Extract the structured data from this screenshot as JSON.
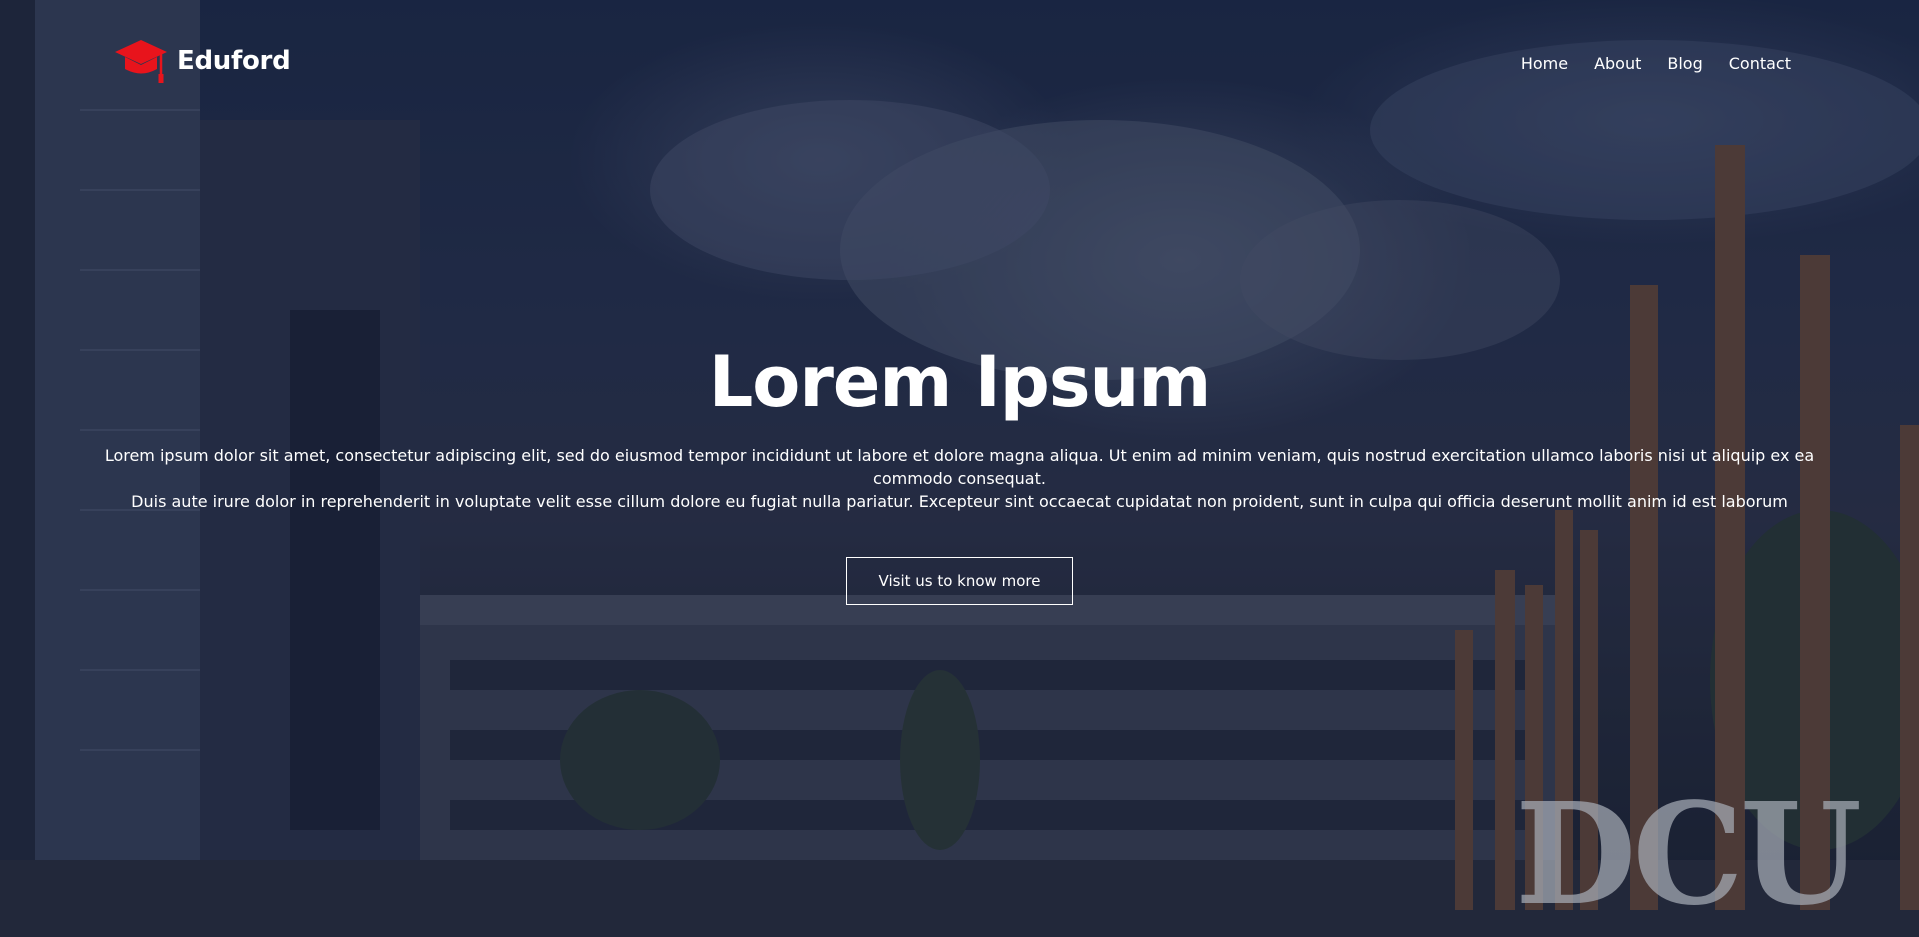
{
  "header": {
    "brand": "Eduford",
    "logo_icon": "graduation-cap-icon",
    "brand_color": "#e8141c"
  },
  "nav": {
    "items": [
      {
        "label": "Home"
      },
      {
        "label": "About"
      },
      {
        "label": "Blog"
      },
      {
        "label": "Contact"
      }
    ]
  },
  "hero": {
    "title": "Lorem Ipsum",
    "paragraph_line1": "Lorem ipsum dolor sit amet, consectetur adipiscing elit, sed do eiusmod tempor incididunt ut labore et dolore magna aliqua. Ut enim ad minim veniam, quis nostrud exercitation ullamco laboris nisi ut aliquip ex ea commodo consequat.",
    "paragraph_line2": "Duis aute irure dolor in reprehenderit in voluptate velit esse cillum dolore eu fugiat nulla pariatur. Excepteur sint occaecat cupidatat non proident, sunt in culpa qui officia deserunt mollit anim id est laborum",
    "cta_label": "Visit us to know more",
    "background_sign": "DCU"
  },
  "colors": {
    "overlay": "#141e3c",
    "text": "#ffffff",
    "accent": "#e8141c"
  }
}
